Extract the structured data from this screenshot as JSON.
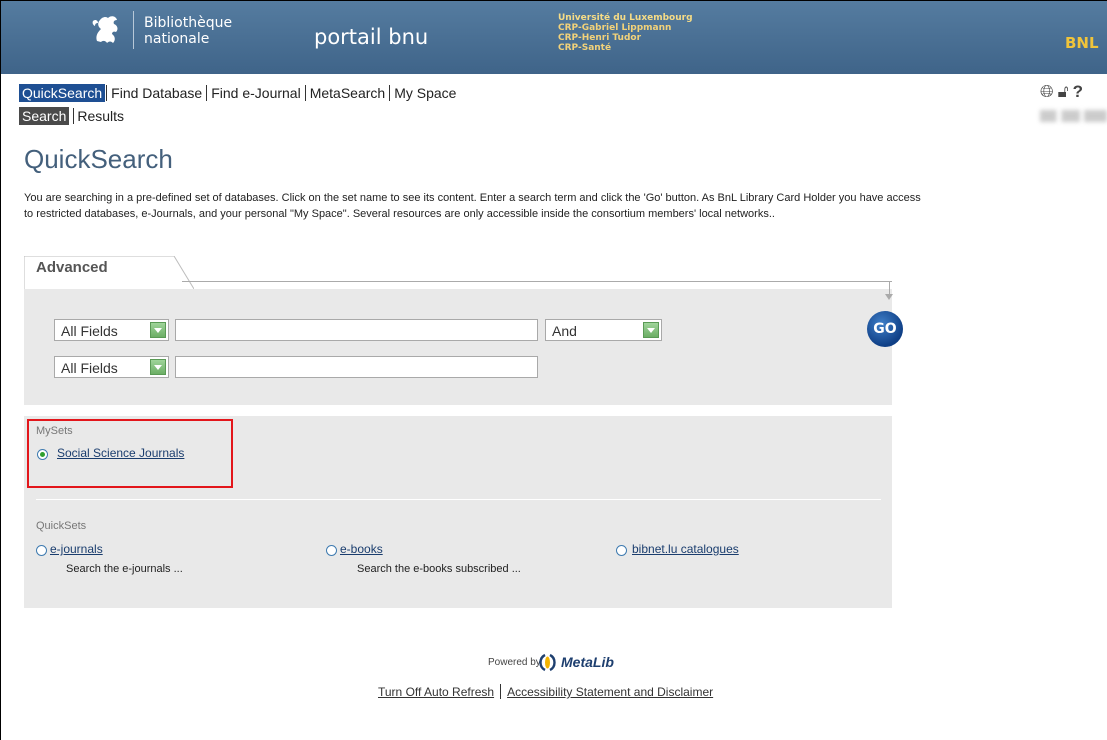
{
  "header": {
    "library_name_line1": "Bibliothèque",
    "library_name_line2": "nationale",
    "portal_title": "portail bnu",
    "partners": [
      "Université du Luxembourg",
      "CRP-Gabriel Lippmann",
      "CRP-Henri Tudor",
      "CRP-Santé"
    ],
    "right_tag": "BNL"
  },
  "nav": {
    "tabs": [
      {
        "label": "QuickSearch",
        "active": true
      },
      {
        "label": "Find Database",
        "active": false
      },
      {
        "label": "Find e-Journal",
        "active": false
      },
      {
        "label": "MetaSearch",
        "active": false
      },
      {
        "label": "My Space",
        "active": false
      }
    ],
    "subtabs": [
      {
        "label": "Search",
        "active": true
      },
      {
        "label": "Results",
        "active": false
      }
    ],
    "tool_icons": [
      "globe-icon",
      "lock-icon",
      "help-icon"
    ]
  },
  "page": {
    "title": "QuickSearch",
    "intro": "You are searching in a pre-defined set of databases. Click on the set name to see its content. Enter a search term and click the 'Go' button. As BnL Library Card Holder you have access to restricted databases, e-Journals, and your personal \"My Space\". Several resources are only accessible inside the consortium members' local networks.."
  },
  "search": {
    "tab_label": "Advanced",
    "row1": {
      "field": "All Fields",
      "value": "",
      "operator": "And"
    },
    "row2": {
      "field": "All Fields",
      "value": ""
    },
    "go_label": "GO"
  },
  "sets": {
    "mysets_heading": "MySets",
    "mysets": [
      {
        "label": "Social Science Journals",
        "selected": true
      }
    ],
    "quicksets_heading": "QuickSets",
    "quicksets": [
      {
        "label": "e-journals",
        "desc": "Search the e-journals ...",
        "selected": false
      },
      {
        "label": "e-books",
        "desc": "Search the e-books subscribed ...",
        "selected": false
      },
      {
        "label": "bibnet.lu catalogues",
        "desc": "",
        "selected": false
      }
    ]
  },
  "footer": {
    "powered_by": "Powered by",
    "product": "MetaLib",
    "links": [
      "Turn Off Auto Refresh",
      "Accessibility Statement and Disclaimer"
    ]
  },
  "colors": {
    "banner": "#4a6f93",
    "active_tab": "#1e4f93",
    "title": "#44607c",
    "highlight_border": "#e3161b",
    "go_button": "#0f3f86"
  }
}
